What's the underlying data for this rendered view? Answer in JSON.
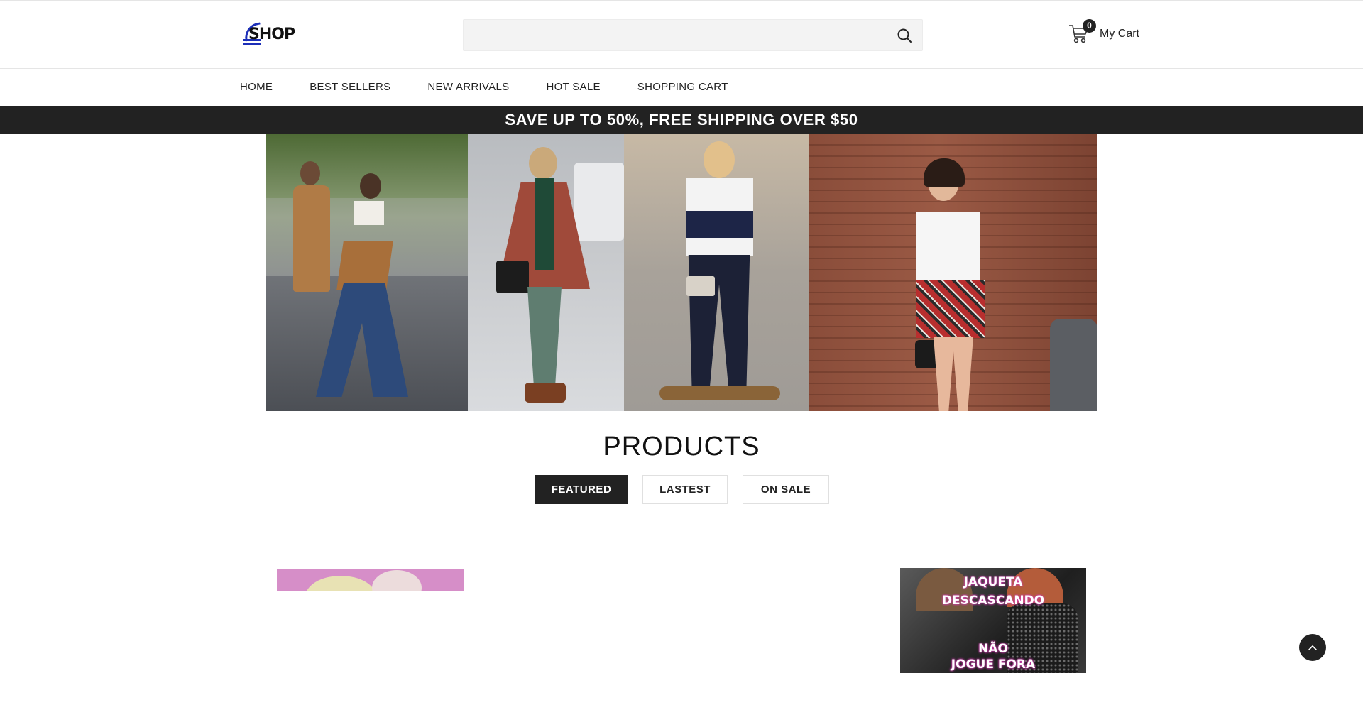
{
  "header": {
    "logo_text": "SHOP",
    "search": {
      "placeholder": "",
      "value": ""
    },
    "cart": {
      "count": "0",
      "label": "My Cart"
    }
  },
  "nav": {
    "items": [
      {
        "label": "HOME"
      },
      {
        "label": "BEST SELLERS"
      },
      {
        "label": "NEW ARRIVALS"
      },
      {
        "label": "HOT SALE"
      },
      {
        "label": "SHOPPING CART"
      }
    ]
  },
  "promo": {
    "text": "SAVE UP TO 50%, FREE SHIPPING OVER $50"
  },
  "products": {
    "title": "PRODUCTS",
    "tabs": [
      {
        "label": "FEATURED",
        "active": true
      },
      {
        "label": "LASTEST",
        "active": false
      },
      {
        "label": "ON SALE",
        "active": false
      }
    ],
    "items": [
      {
        "image_caption_lines": []
      },
      {
        "image_caption_lines": [
          "JAQUETA",
          "DESCASCANDO",
          "NÃO",
          "JOGUE FORA"
        ]
      }
    ]
  },
  "colors": {
    "accent": "#222222",
    "logo_blue": "#1c2fb8",
    "background": "#ffffff"
  },
  "icons": {
    "search": "search-icon",
    "cart": "cart-icon",
    "back_to_top": "chevron-up-icon"
  }
}
